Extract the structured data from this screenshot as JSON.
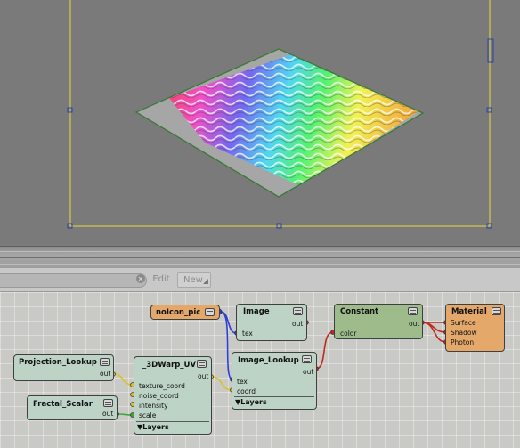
{
  "toolbar": {
    "edit_label": "Edit",
    "new_label": "New"
  },
  "nodes": {
    "noicon_pic": {
      "title": "noIcon_pic"
    },
    "image": {
      "title": "Image",
      "out": "out",
      "tex": "tex"
    },
    "constant": {
      "title": "Constant",
      "out": "out",
      "color": "color"
    },
    "material": {
      "title": "Material",
      "surface": "Surface",
      "shadow": "Shadow",
      "photon": "Photon"
    },
    "projection_lookup": {
      "title": "Projection_Lookup",
      "out": "out"
    },
    "warp_uv": {
      "title": "_3DWarp_UV",
      "out": "out",
      "texture_coord": "texture_coord",
      "noise_coord": "noise_coord",
      "intensity": "intensity",
      "scale": "scale",
      "layers": "▼Layers"
    },
    "image_lookup": {
      "title": "Image_Lookup",
      "out": "out",
      "tex": "tex",
      "coord": "coord",
      "layers": "▼Layers"
    },
    "fractal_scalar": {
      "title": "Fractal_Scalar",
      "out": "out"
    }
  },
  "colors": {
    "viewport_bg": "#7a7a7a",
    "camera_frame": "#e6dc3c",
    "handle": "#2c3fae",
    "wire_blue": "#2b3fd6",
    "wire_red": "#c0281e",
    "wire_yellow": "#d8c22a",
    "wire_green": "#3ca83c"
  },
  "icons": [
    "search-clear-icon",
    "new-dropdown-icon",
    "node-toggle-icon"
  ]
}
